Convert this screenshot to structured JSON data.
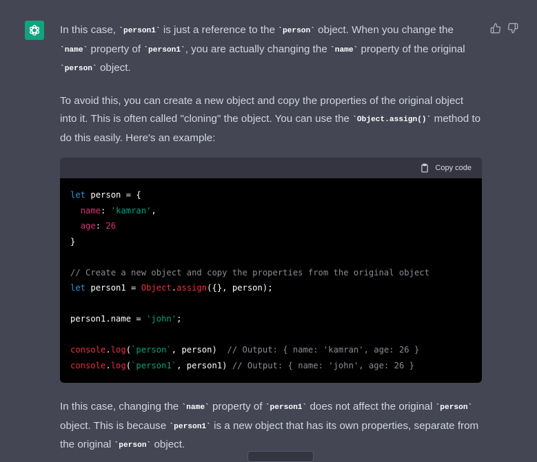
{
  "message": {
    "p1": [
      "In this case, ",
      "`person1`",
      " is just a reference to the ",
      "`person`",
      " object. When you change the ",
      "`name`",
      " property of ",
      "`person1`",
      ", you are actually changing the ",
      "`name`",
      " property of the original ",
      "`person`",
      " object."
    ],
    "p2": [
      "To avoid this, you can create a new object and copy the properties of the original object into it. This is often called \"cloning\" the object. You can use the ",
      "`Object.assign()`",
      " method to do this easily. Here's an example:"
    ],
    "p3": [
      "In this case, changing the ",
      "`name`",
      " property of ",
      "`person1`",
      " does not affect the original ",
      "`person`",
      " object. This is because ",
      "`person1`",
      " is a new object that has its own properties, separate from the original ",
      "`person`",
      " object."
    ]
  },
  "code": {
    "copy_label": "Copy code",
    "lines": [
      [
        [
          "kw",
          "let"
        ],
        [
          "t",
          " person = {"
        ]
      ],
      [
        [
          "t",
          "  "
        ],
        [
          "key",
          "name"
        ],
        [
          "t",
          ": "
        ],
        [
          "str",
          "'kamran'"
        ],
        [
          "t",
          ","
        ]
      ],
      [
        [
          "t",
          "  "
        ],
        [
          "key",
          "age"
        ],
        [
          "t",
          ": "
        ],
        [
          "num",
          "26"
        ]
      ],
      [
        [
          "t",
          "}"
        ]
      ],
      [
        [
          "t",
          ""
        ]
      ],
      [
        [
          "cmt",
          "// Create a new object and copy the properties from the original object"
        ]
      ],
      [
        [
          "kw",
          "let"
        ],
        [
          "t",
          " person1 = "
        ],
        [
          "fn",
          "Object"
        ],
        [
          "t",
          "."
        ],
        [
          "fn",
          "assign"
        ],
        [
          "t",
          "({}, person);"
        ]
      ],
      [
        [
          "t",
          ""
        ]
      ],
      [
        [
          "t",
          "person1.name = "
        ],
        [
          "str",
          "'john'"
        ],
        [
          "t",
          ";"
        ]
      ],
      [
        [
          "t",
          ""
        ]
      ],
      [
        [
          "fn",
          "console"
        ],
        [
          "t",
          "."
        ],
        [
          "fn",
          "log"
        ],
        [
          "t",
          "("
        ],
        [
          "str",
          "`person`"
        ],
        [
          "t",
          ", person)  "
        ],
        [
          "cmt",
          "// Output: { name: 'kamran', age: 26 }"
        ]
      ],
      [
        [
          "fn",
          "console"
        ],
        [
          "t",
          "."
        ],
        [
          "fn",
          "log"
        ],
        [
          "t",
          "("
        ],
        [
          "str",
          "`person1`"
        ],
        [
          "t",
          ", person1) "
        ],
        [
          "cmt",
          "// Output: { name: 'john', age: 26 }"
        ]
      ]
    ]
  },
  "icons": {
    "avatar": "openai-logo-icon",
    "like": "thumbs-up-icon",
    "dislike": "thumbs-down-icon",
    "copy": "clipboard-icon"
  },
  "colors": {
    "bg": "#444654",
    "avatar": "#10a37f",
    "code_bg": "#000000",
    "code_header": "#343541"
  }
}
